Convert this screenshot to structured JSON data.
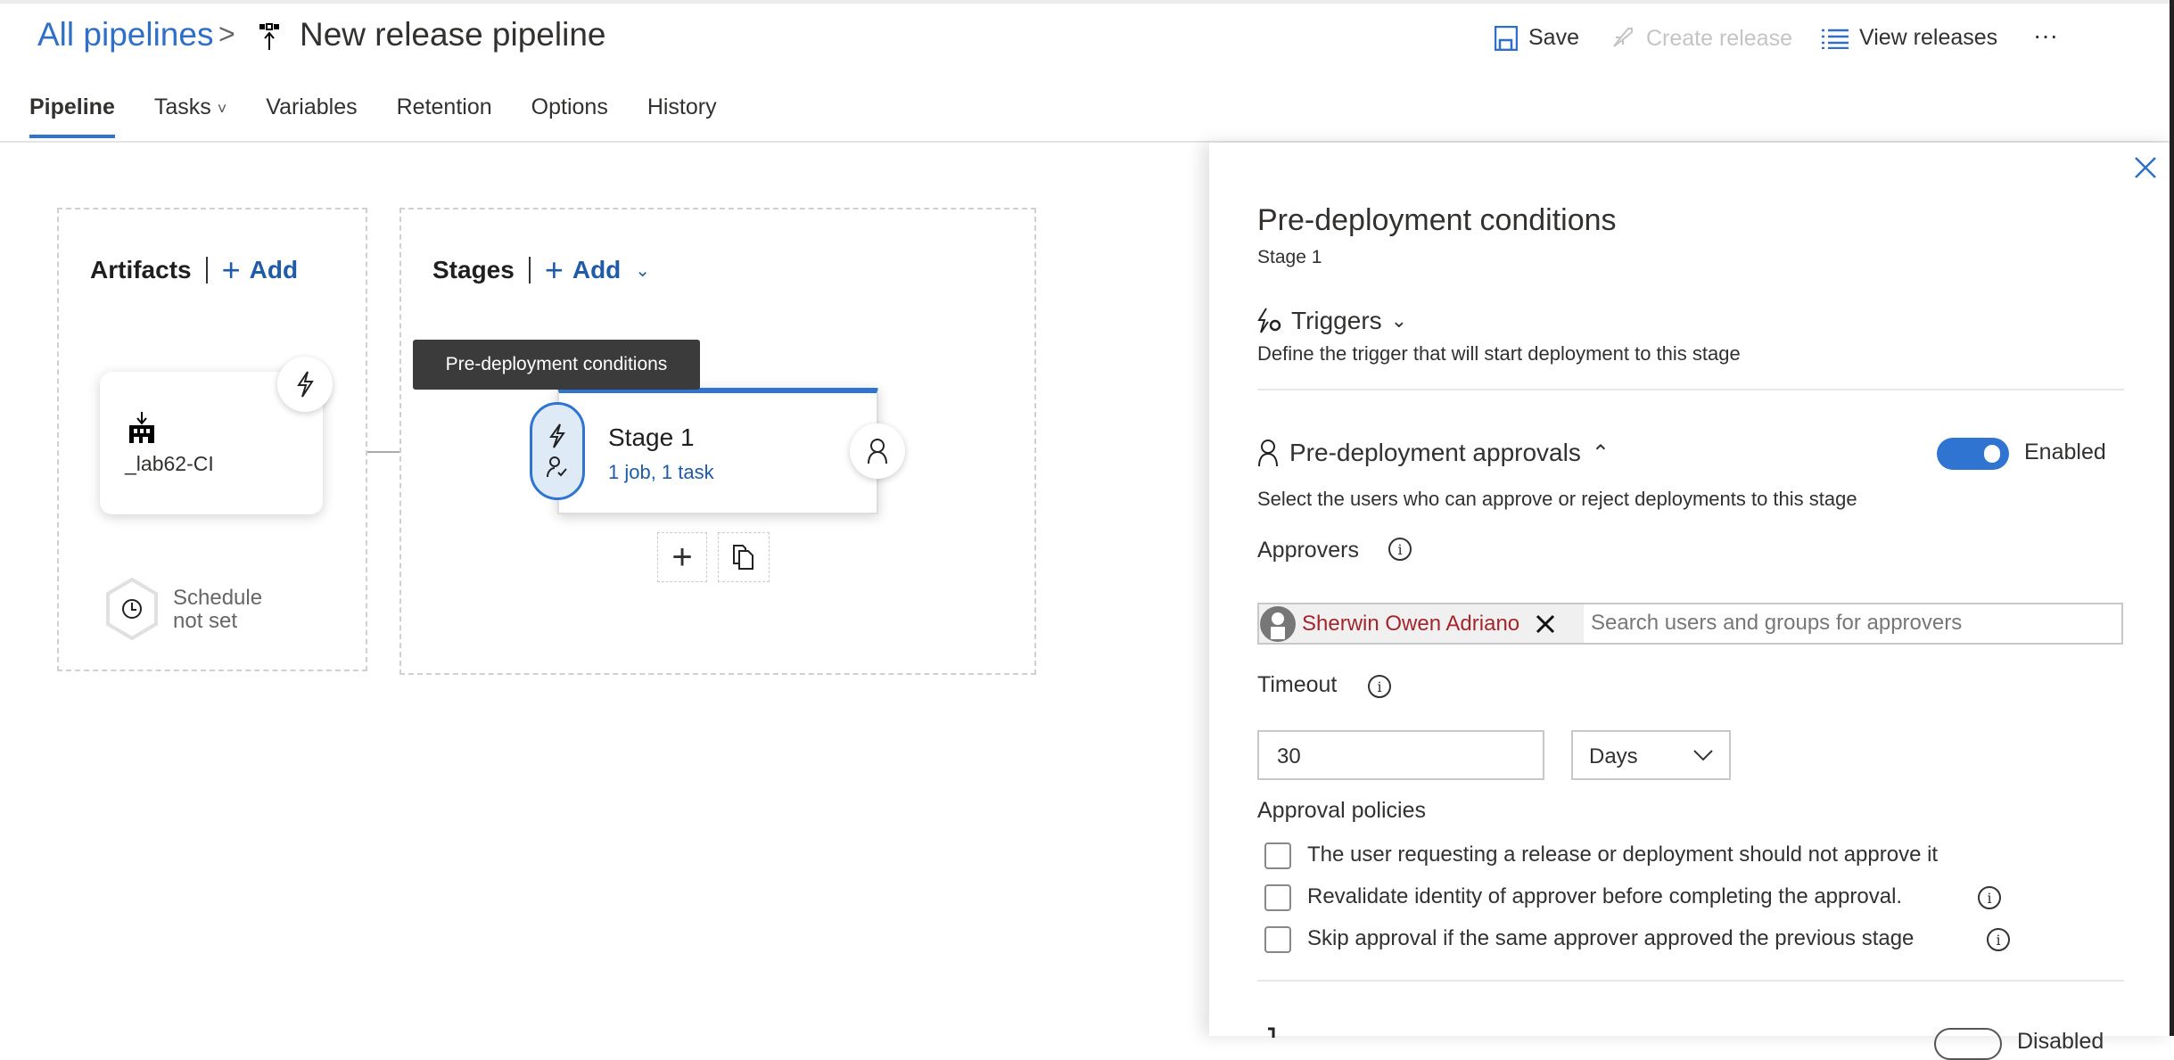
{
  "header": {
    "breadcrumb": "All pipelines",
    "separator": ">",
    "title": "New release pipeline"
  },
  "toolbar": {
    "save": "Save",
    "create_release": "Create release",
    "view_releases": "View releases",
    "more": "···"
  },
  "tabs": [
    {
      "label": "Pipeline",
      "active": true
    },
    {
      "label": "Tasks",
      "chevron": "˅"
    },
    {
      "label": "Variables"
    },
    {
      "label": "Retention"
    },
    {
      "label": "Options"
    },
    {
      "label": "History"
    }
  ],
  "artifacts": {
    "heading": "Artifacts",
    "add": "Add",
    "card_name": "_lab62-CI",
    "schedule_line1": "Schedule",
    "schedule_line2": "not set"
  },
  "stages": {
    "heading": "Stages",
    "add": "Add",
    "tooltip": "Pre-deployment conditions",
    "stage_name": "Stage 1",
    "stage_summary": "1 job, 1 task"
  },
  "panel": {
    "title": "Pre-deployment conditions",
    "subtitle": "Stage 1",
    "triggers": {
      "label": "Triggers",
      "description": "Define the trigger that will start deployment to this stage"
    },
    "approvals": {
      "label": "Pre-deployment approvals",
      "toggle_label": "Enabled",
      "toggle_on": true,
      "description": "Select the users who can approve or reject deployments to this stage"
    },
    "approvers_label": "Approvers",
    "approver_chip": "Sherwin Owen Adriano",
    "approver_placeholder": "Search users and groups for approvers",
    "timeout_label": "Timeout",
    "timeout_value": "30",
    "timeout_unit": "Days",
    "policies_label": "Approval policies",
    "policies": [
      {
        "label": "The user requesting a release or deployment should not approve it",
        "checked": false
      },
      {
        "label": "Revalidate identity of approver before completing the approval.",
        "checked": false,
        "info": true
      },
      {
        "label": "Skip approval if the same approver approved the previous stage",
        "checked": false,
        "info": true
      }
    ],
    "next_toggle_label": "Disabled"
  },
  "colors": {
    "accent": "#2f74d0",
    "link": "#1f5ba6",
    "chip_text": "#a4262c",
    "tooltip_bg": "#3b3b3b"
  }
}
